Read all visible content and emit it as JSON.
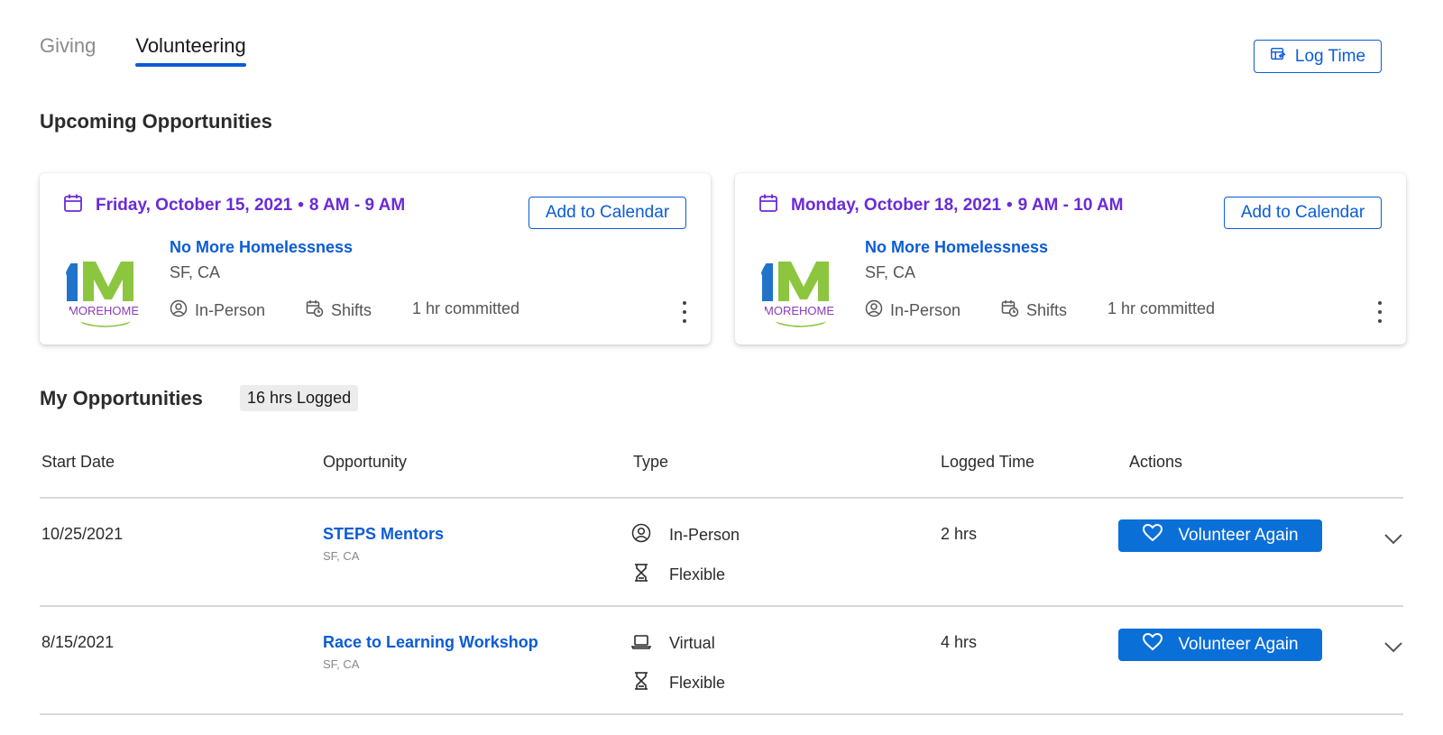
{
  "tabs": [
    {
      "label": "Giving",
      "active": false
    },
    {
      "label": "Volunteering",
      "active": true
    }
  ],
  "log_time_label": "Log Time",
  "upcoming": {
    "title": "Upcoming Opportunities",
    "cards": [
      {
        "date": "Friday, October 15, 2021",
        "time": "8 AM - 9 AM",
        "add_calendar_label": "Add to Calendar",
        "org_name": "No More Homelessness",
        "location": "SF, CA",
        "mode": "In-Person",
        "shift": "Shifts",
        "commitment": "1 hr committed",
        "logo_text": "MOREHOME"
      },
      {
        "date": "Monday, October 18, 2021",
        "time": "9 AM - 10 AM",
        "add_calendar_label": "Add to Calendar",
        "org_name": "No More Homelessness",
        "location": "SF, CA",
        "mode": "In-Person",
        "shift": "Shifts",
        "commitment": "1 hr committed",
        "logo_text": "MOREHOME"
      }
    ]
  },
  "my_opportunities": {
    "title": "My Opportunities",
    "logged_badge": "16 hrs Logged",
    "columns": [
      "Start Date",
      "Opportunity",
      "Type",
      "Logged Time",
      "Actions"
    ],
    "rows": [
      {
        "start_date": "10/25/2021",
        "opportunity": "STEPS Mentors",
        "location": "SF, CA",
        "type_primary": "In-Person",
        "type_secondary": "Flexible",
        "logged_time": "2 hrs",
        "action_label": "Volunteer Again"
      },
      {
        "start_date": "8/15/2021",
        "opportunity": "Race to Learning Workshop",
        "location": "SF, CA",
        "type_primary": "Virtual",
        "type_secondary": "Flexible",
        "logged_time": "4 hrs",
        "action_label": "Volunteer Again"
      }
    ]
  },
  "colors": {
    "accent": "#0b5cd5",
    "date_purple": "#6b2bd6",
    "button_fill": "#0b6fd8",
    "logo_blue": "#1f73c9",
    "logo_green": "#8cc63f",
    "logo_purple": "#8a3bb8"
  },
  "icons": {
    "log_time": "timesheet-icon",
    "calendar": "calendar-icon",
    "in_person": "person-circle-icon",
    "shifts": "calendar-clock-icon",
    "virtual": "laptop-icon",
    "flexible": "hourglass-icon",
    "volunteer": "heart-icon",
    "expand": "chevron-down-icon",
    "more": "kebab-menu-icon"
  }
}
